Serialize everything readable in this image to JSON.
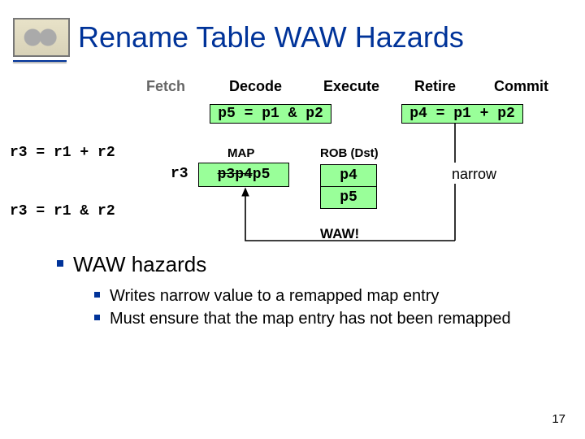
{
  "title": "Rename Table WAW Hazards",
  "stages": {
    "fetch": "Fetch",
    "decode": "Decode",
    "execute": "Execute",
    "retire": "Retire",
    "commit": "Commit"
  },
  "code": {
    "l1": "r3 = r1 + r2",
    "l2": "r3 = r1 & r2"
  },
  "decode_box": "p5 = p1 & p2",
  "retire_box": "p4 = p1 + p2",
  "labels": {
    "map": "MAP",
    "rob": "ROB (Dst)",
    "r3": "r3",
    "narrow": "narrow",
    "waw": "WAW!"
  },
  "map_cell": {
    "struck1": "p3",
    "struck2": "p4",
    "current": "p5"
  },
  "rob": [
    "p4",
    "p5"
  ],
  "bullets": {
    "top": "WAW hazards",
    "s1": "Writes narrow value to a remapped map entry",
    "s2": "Must ensure that the map entry has not been remapped"
  },
  "page": "17"
}
